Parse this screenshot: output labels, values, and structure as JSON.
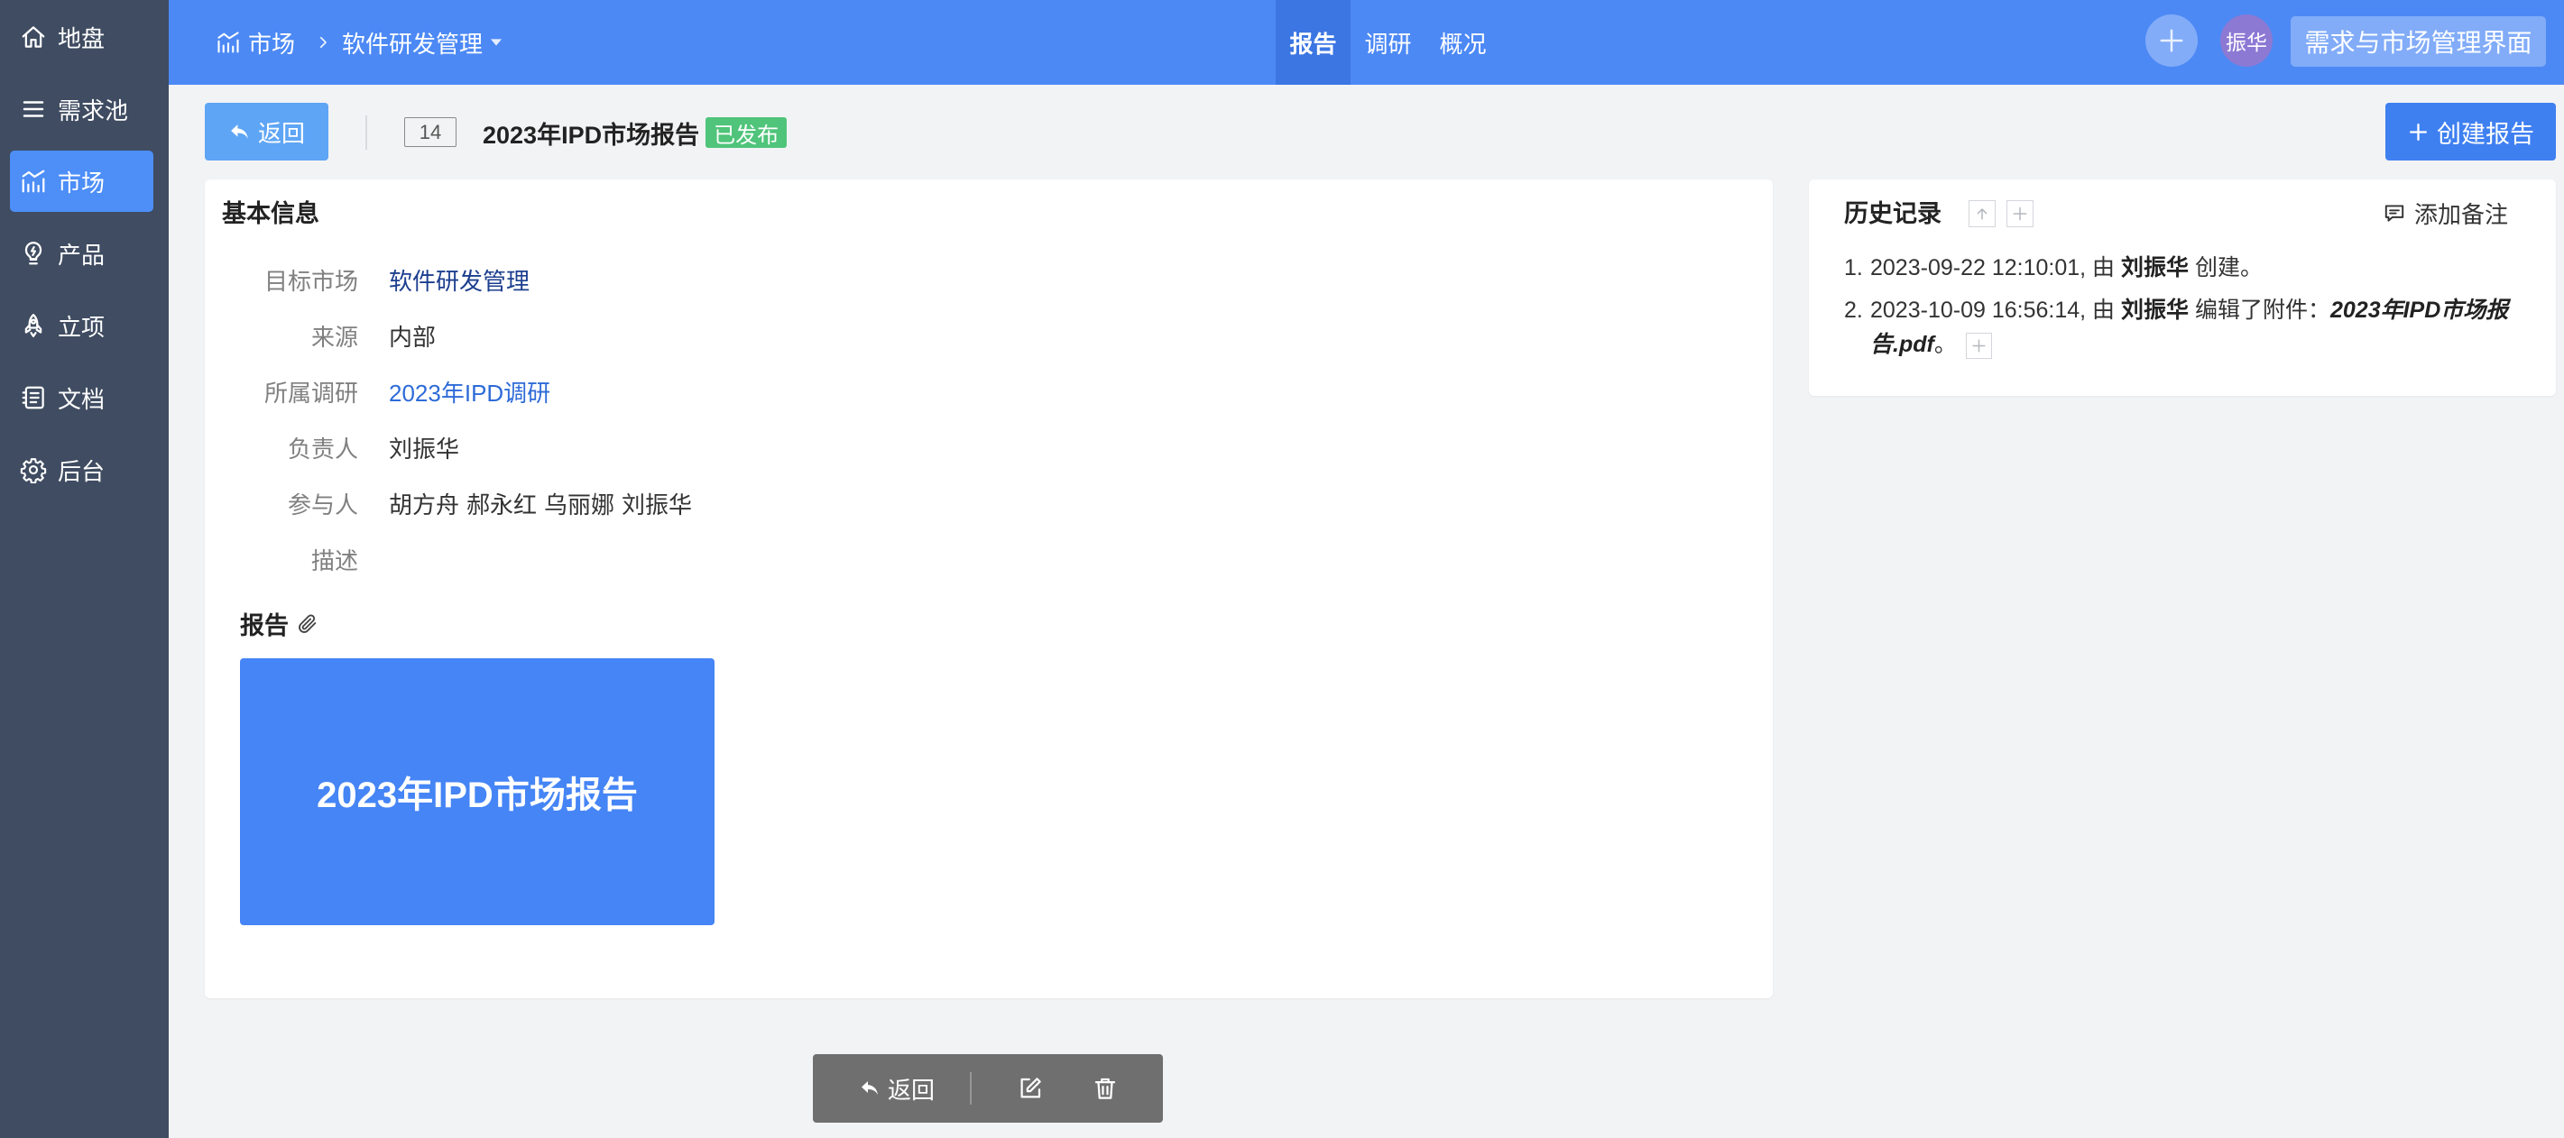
{
  "colors": {
    "sidebar_bg": "#3f4c61",
    "sidebar_active": "#4d8ef7",
    "header_bg": "#4c89f5",
    "header_tab_active": "#3c76e3",
    "primary_button": "#3f80f1",
    "back_button": "#5ea5f5",
    "status_published": "#4fc47a",
    "thumbnail_bg": "#4585f5",
    "avatar_bg": "#8c79d4",
    "action_bar_bg": "#6f6f6f"
  },
  "sidebar": {
    "items": [
      {
        "label": "地盘",
        "icon": "home-icon"
      },
      {
        "label": "需求池",
        "icon": "list-icon"
      },
      {
        "label": "市场",
        "icon": "market-chart-icon",
        "active": true
      },
      {
        "label": "产品",
        "icon": "bulb-icon"
      },
      {
        "label": "立项",
        "icon": "rocket-icon"
      },
      {
        "label": "文档",
        "icon": "document-icon"
      },
      {
        "label": "后台",
        "icon": "gear-icon"
      }
    ]
  },
  "header": {
    "module": {
      "label": "市场",
      "icon": "market-chart-icon"
    },
    "current_market": "软件研发管理",
    "tabs": [
      {
        "label": "报告",
        "active": true
      },
      {
        "label": "调研"
      },
      {
        "label": "概况"
      }
    ],
    "avatar": "振华",
    "app_switcher": "需求与市场管理界面"
  },
  "toolbar": {
    "back": "返回",
    "id": "14",
    "title": "2023年IPD市场报告",
    "status": "已发布",
    "create": "创建报告"
  },
  "basic_info": {
    "heading": "基本信息",
    "fields": [
      {
        "label": "目标市场",
        "value": "软件研发管理"
      },
      {
        "label": "来源",
        "value": "内部"
      },
      {
        "label": "所属调研",
        "value": "2023年IPD调研"
      },
      {
        "label": "负责人",
        "value": "刘振华"
      },
      {
        "label": "参与人",
        "values": [
          "胡方舟",
          "郝永红",
          "乌丽娜",
          "刘振华"
        ]
      },
      {
        "label": "描述"
      }
    ]
  },
  "report": {
    "heading": "报告",
    "thumbnail_title": "2023年IPD市场报告"
  },
  "history": {
    "heading": "历史记录",
    "add_note": "添加备注",
    "entries": [
      {
        "index": "1.",
        "time": "2023-09-22 12:10:01",
        "by": ", 由",
        "actor": "刘振华",
        "action": "创建。"
      },
      {
        "index": "2.",
        "time": "2023-10-09 16:56:14",
        "by": ", 由",
        "actor": "刘振华",
        "action": "编辑了附件：",
        "attachment": "2023年IPD市场报告.pdf",
        "end": "。"
      }
    ]
  },
  "action_bar": {
    "back": "返回"
  }
}
